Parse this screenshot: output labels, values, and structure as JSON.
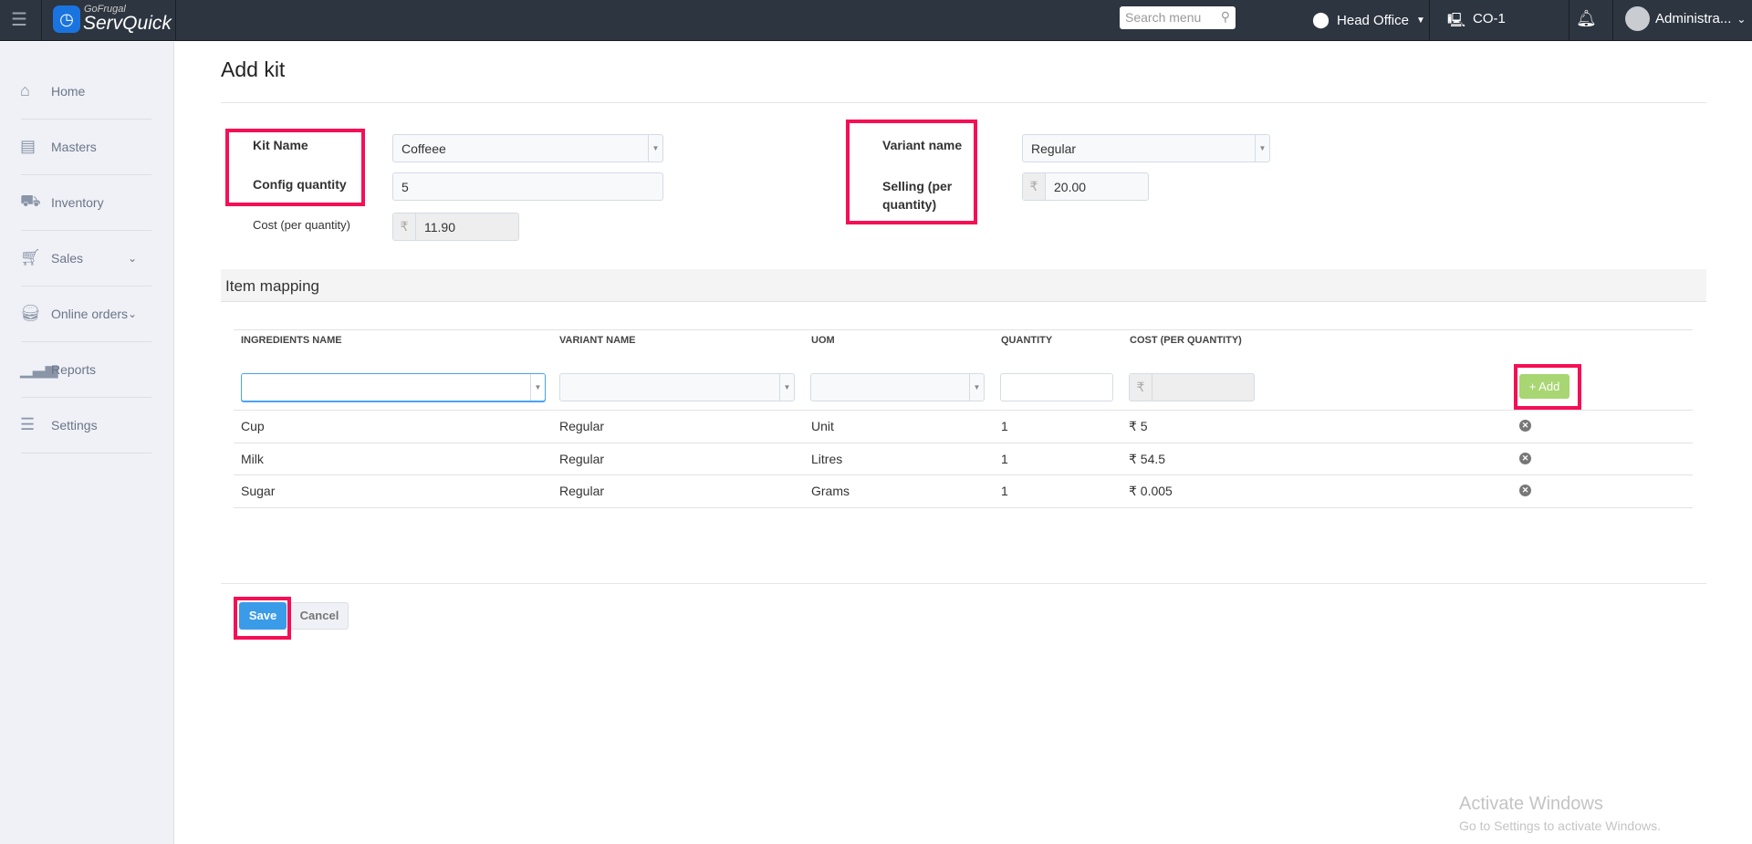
{
  "header": {
    "brand_top": "GoFrugal",
    "brand": "ServQuick",
    "search_placeholder": "Search menu",
    "location": "Head Office",
    "counter": "CO-1",
    "user": "Administra..."
  },
  "sidebar": {
    "items": [
      {
        "label": "Home"
      },
      {
        "label": "Masters"
      },
      {
        "label": "Inventory"
      },
      {
        "label": "Sales"
      },
      {
        "label": "Online orders"
      },
      {
        "label": "Reports"
      },
      {
        "label": "Settings"
      }
    ]
  },
  "page": {
    "title": "Add kit"
  },
  "form": {
    "kit_name_label": "Kit Name",
    "kit_name_value": "Coffeee",
    "config_qty_label": "Config quantity",
    "config_qty_value": "5",
    "cost_label": "Cost (per quantity)",
    "cost_value": "11.90",
    "variant_label": "Variant name",
    "variant_value": "Regular",
    "selling_label": "Selling (per quantity)",
    "selling_value": "20.00",
    "currency": "₹"
  },
  "mapping": {
    "title": "Item mapping",
    "columns": [
      "INGREDIENTS NAME",
      "VARIANT NAME",
      "UOM",
      "QUANTITY",
      "COST (PER QUANTITY)"
    ],
    "add_label": "+ Add",
    "rows": [
      {
        "name": "Cup",
        "variant": "Regular",
        "uom": "Unit",
        "qty": "1",
        "cost": "₹ 5"
      },
      {
        "name": "Milk",
        "variant": "Regular",
        "uom": "Litres",
        "qty": "1",
        "cost": "₹ 54.5"
      },
      {
        "name": "Sugar",
        "variant": "Regular",
        "uom": "Grams",
        "qty": "1",
        "cost": "₹ 0.005"
      }
    ]
  },
  "actions": {
    "save": "Save",
    "cancel": "Cancel"
  },
  "watermark": {
    "line1": "Activate Windows",
    "line2": "Go to Settings to activate Windows."
  }
}
